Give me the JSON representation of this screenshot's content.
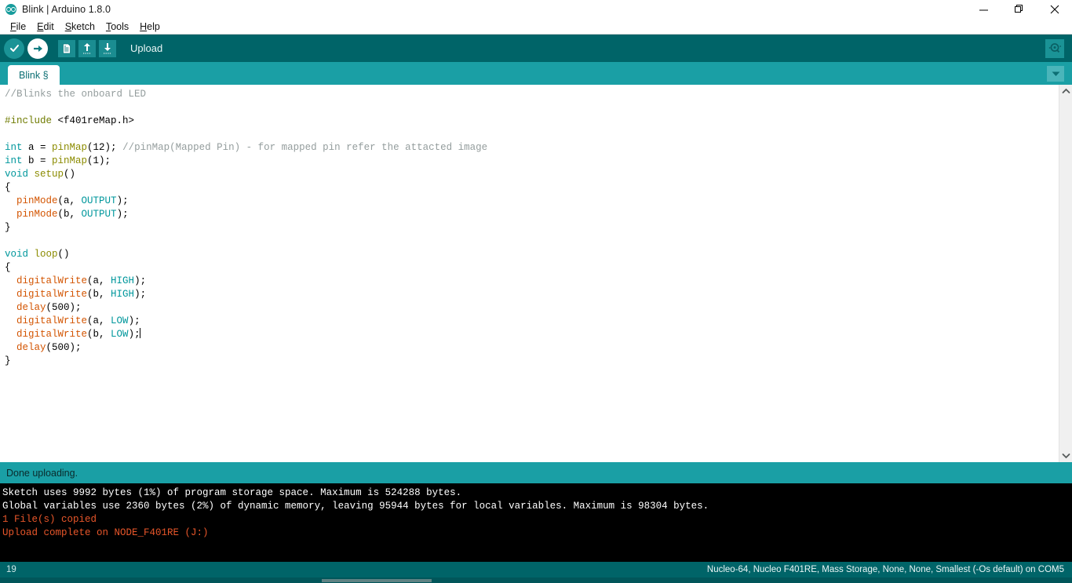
{
  "window": {
    "title": "Blink | Arduino 1.8.0",
    "app_icon": "arduino-logo-icon",
    "minimize_label": "—",
    "maximize_label": "❐",
    "close_label": "✕"
  },
  "menubar": {
    "items": [
      {
        "label": "File",
        "mnemonic": "F"
      },
      {
        "label": "Edit",
        "mnemonic": "E"
      },
      {
        "label": "Sketch",
        "mnemonic": "S"
      },
      {
        "label": "Tools",
        "mnemonic": "T"
      },
      {
        "label": "Help",
        "mnemonic": "H"
      }
    ]
  },
  "toolbar": {
    "verify_tooltip": "Verify",
    "upload_tooltip": "Upload",
    "new_tooltip": "New",
    "open_tooltip": "Open",
    "save_tooltip": "Save",
    "active_label": "Upload",
    "serial_monitor_tooltip": "Serial Monitor",
    "bg_color": "#006468",
    "upload_active": true
  },
  "tabs": {
    "items": [
      {
        "label": "Blink §",
        "active": true,
        "modified": true
      }
    ],
    "dropdown_icon": "chevron-down-icon",
    "strip_color": "#1a9fa5"
  },
  "editor": {
    "lines": [
      {
        "tokens": [
          {
            "t": "//Blinks the onboard LED",
            "c": "cm"
          }
        ]
      },
      {
        "tokens": []
      },
      {
        "tokens": [
          {
            "t": "#include",
            "c": "pre"
          },
          {
            "t": " <f401reMap.h>",
            "c": "num"
          }
        ]
      },
      {
        "tokens": []
      },
      {
        "tokens": [
          {
            "t": "int",
            "c": "kw"
          },
          {
            "t": " a = ",
            "c": "num"
          },
          {
            "t": "pinMap",
            "c": "fn2"
          },
          {
            "t": "(12); ",
            "c": "num"
          },
          {
            "t": "//pinMap(Mapped Pin) - for mapped pin refer the attacted image",
            "c": "cm"
          }
        ]
      },
      {
        "tokens": [
          {
            "t": "int",
            "c": "kw"
          },
          {
            "t": " b = ",
            "c": "num"
          },
          {
            "t": "pinMap",
            "c": "fn2"
          },
          {
            "t": "(1);",
            "c": "num"
          }
        ]
      },
      {
        "tokens": [
          {
            "t": "void",
            "c": "kw"
          },
          {
            "t": " ",
            "c": "num"
          },
          {
            "t": "setup",
            "c": "fn2"
          },
          {
            "t": "()",
            "c": "num"
          }
        ]
      },
      {
        "tokens": [
          {
            "t": "{",
            "c": "num"
          }
        ]
      },
      {
        "tokens": [
          {
            "t": "  ",
            "c": "num"
          },
          {
            "t": "pinMode",
            "c": "fn"
          },
          {
            "t": "(a, ",
            "c": "num"
          },
          {
            "t": "OUTPUT",
            "c": "lit"
          },
          {
            "t": ");",
            "c": "num"
          }
        ]
      },
      {
        "tokens": [
          {
            "t": "  ",
            "c": "num"
          },
          {
            "t": "pinMode",
            "c": "fn"
          },
          {
            "t": "(b, ",
            "c": "num"
          },
          {
            "t": "OUTPUT",
            "c": "lit"
          },
          {
            "t": ");",
            "c": "num"
          }
        ]
      },
      {
        "tokens": [
          {
            "t": "}",
            "c": "num"
          }
        ]
      },
      {
        "tokens": []
      },
      {
        "tokens": [
          {
            "t": "void",
            "c": "kw"
          },
          {
            "t": " ",
            "c": "num"
          },
          {
            "t": "loop",
            "c": "fn2"
          },
          {
            "t": "()",
            "c": "num"
          }
        ]
      },
      {
        "tokens": [
          {
            "t": "{",
            "c": "num"
          }
        ]
      },
      {
        "tokens": [
          {
            "t": "  ",
            "c": "num"
          },
          {
            "t": "digitalWrite",
            "c": "fn"
          },
          {
            "t": "(a, ",
            "c": "num"
          },
          {
            "t": "HIGH",
            "c": "lit"
          },
          {
            "t": ");",
            "c": "num"
          }
        ]
      },
      {
        "tokens": [
          {
            "t": "  ",
            "c": "num"
          },
          {
            "t": "digitalWrite",
            "c": "fn"
          },
          {
            "t": "(b, ",
            "c": "num"
          },
          {
            "t": "HIGH",
            "c": "lit"
          },
          {
            "t": ");",
            "c": "num"
          }
        ]
      },
      {
        "tokens": [
          {
            "t": "  ",
            "c": "num"
          },
          {
            "t": "delay",
            "c": "fn"
          },
          {
            "t": "(500);",
            "c": "num"
          }
        ]
      },
      {
        "tokens": [
          {
            "t": "  ",
            "c": "num"
          },
          {
            "t": "digitalWrite",
            "c": "fn"
          },
          {
            "t": "(a, ",
            "c": "num"
          },
          {
            "t": "LOW",
            "c": "lit"
          },
          {
            "t": ");",
            "c": "num"
          }
        ]
      },
      {
        "tokens": [
          {
            "t": "  ",
            "c": "num"
          },
          {
            "t": "digitalWrite",
            "c": "fn"
          },
          {
            "t": "(b, ",
            "c": "num"
          },
          {
            "t": "LOW",
            "c": "lit"
          },
          {
            "t": ");",
            "c": "num"
          }
        ],
        "caret": true
      },
      {
        "tokens": [
          {
            "t": "  ",
            "c": "num"
          },
          {
            "t": "delay",
            "c": "fn"
          },
          {
            "t": "(500);",
            "c": "num"
          }
        ]
      },
      {
        "tokens": [
          {
            "t": "}",
            "c": "num"
          }
        ]
      }
    ],
    "scrollbar": {
      "up_icon": "chevron-up-icon",
      "down_icon": "chevron-down-icon"
    }
  },
  "status": {
    "message": "Done uploading.",
    "bg_color": "#1a9fa5"
  },
  "console": {
    "lines": [
      {
        "text": "Sketch uses 9992 bytes (1%) of program storage space. Maximum is 524288 bytes.",
        "error": false
      },
      {
        "text": "Global variables use 2360 bytes (2%) of dynamic memory, leaving 95944 bytes for local variables. Maximum is 98304 bytes.",
        "error": false
      },
      {
        "text": "1 File(s) copied",
        "error": true
      },
      {
        "text": "Upload complete on NODE_F401RE (J:)",
        "error": true
      }
    ],
    "bg_color": "#000000",
    "error_color": "#e8562a"
  },
  "bottombar": {
    "line_number": "19",
    "board_info": "Nucleo-64, Nucleo F401RE, Mass Storage, None, None, Smallest (-Os default) on COM5",
    "bg_color": "#006468"
  }
}
